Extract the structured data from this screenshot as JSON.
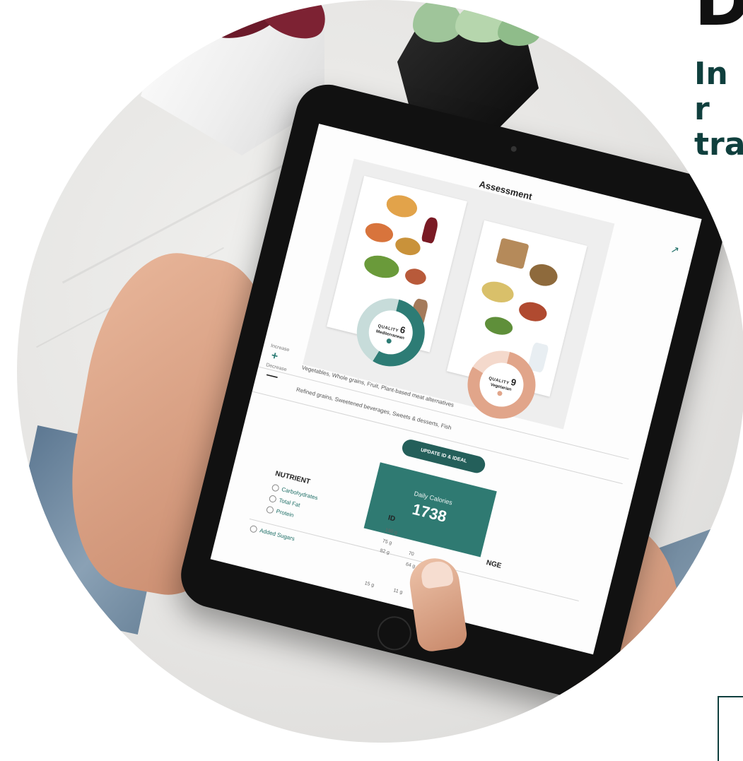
{
  "headline": {
    "big": "D",
    "sub_line1": "In r",
    "sub_line2": "tra"
  },
  "screen": {
    "title": "Assessment",
    "share_icon": "share-icon",
    "plans": [
      {
        "quality_label": "QUALITY",
        "quality_value": "6",
        "name": "Mediterranean",
        "color": "#2d7c75"
      },
      {
        "quality_label": "QUALITY",
        "quality_value": "9",
        "name": "Vegetarian",
        "color": "#e1a58a"
      }
    ],
    "increase": {
      "label": "Increase",
      "symbol": "+",
      "text": "Vegetables, Whole grains, Fruit, Plant-based meat alternatives"
    },
    "decrease": {
      "label": "Decrease",
      "symbol": "—",
      "text": "Refined grains, Sweetened beverages, Sweets & desserts, Fish"
    },
    "update_button": "UPDATE ID & IDEAL",
    "calories": {
      "label": "Daily Calories",
      "value": "1738"
    },
    "nutrients": {
      "title": "NUTRIENT",
      "col_id": "ID",
      "col_change": "NGE",
      "rows": [
        {
          "name": "Carbohydrates",
          "id": "180 g"
        },
        {
          "name": "Total Fat",
          "id": "75 g"
        },
        {
          "name": "Protein",
          "id": "82 g",
          "other": "70",
          "change": "64 g"
        },
        {
          "name": "Added Sugars",
          "id": "15 g",
          "other": "11 g"
        }
      ]
    }
  },
  "colors": {
    "accent": "#2f7a72",
    "accent_dark": "#245f5a",
    "peach": "#e1a58a",
    "headline": "#0f3f3d"
  }
}
